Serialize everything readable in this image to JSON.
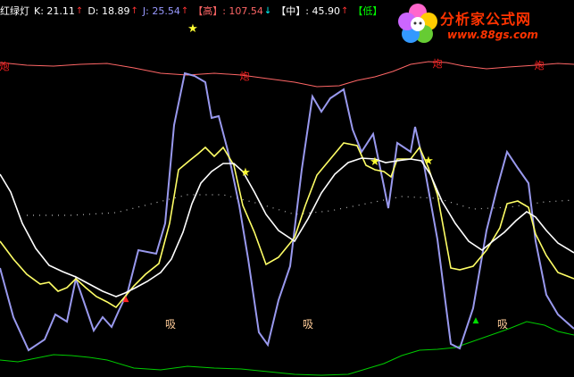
{
  "legend": {
    "title": "红绿灯",
    "k": "K: 21.11",
    "d": "D: 18.89",
    "j": "J: 25.54",
    "high": "【高】: 107.54",
    "mid": "【中】: 45.90",
    "low": "【低】",
    "arrow_up": "↑",
    "arrow_down": "↓"
  },
  "logo": {
    "title": "分析家公式网",
    "url": "www.88gs.com"
  },
  "markers": {
    "pao": "炮",
    "xi": "吸",
    "star": "★",
    "triangle_up": "▲"
  },
  "colors": {
    "background": "#000000",
    "k_line": "#ffff66",
    "d_line": "#ffffff",
    "j_line": "#9999ff",
    "high_line": "#ff6666",
    "low_line": "#00cc00",
    "mid_dots": "#cccccc",
    "text_white": "#ffffff",
    "text_red": "#ff0000",
    "text_green": "#00ff00",
    "text_cyan": "#00ffff"
  }
}
